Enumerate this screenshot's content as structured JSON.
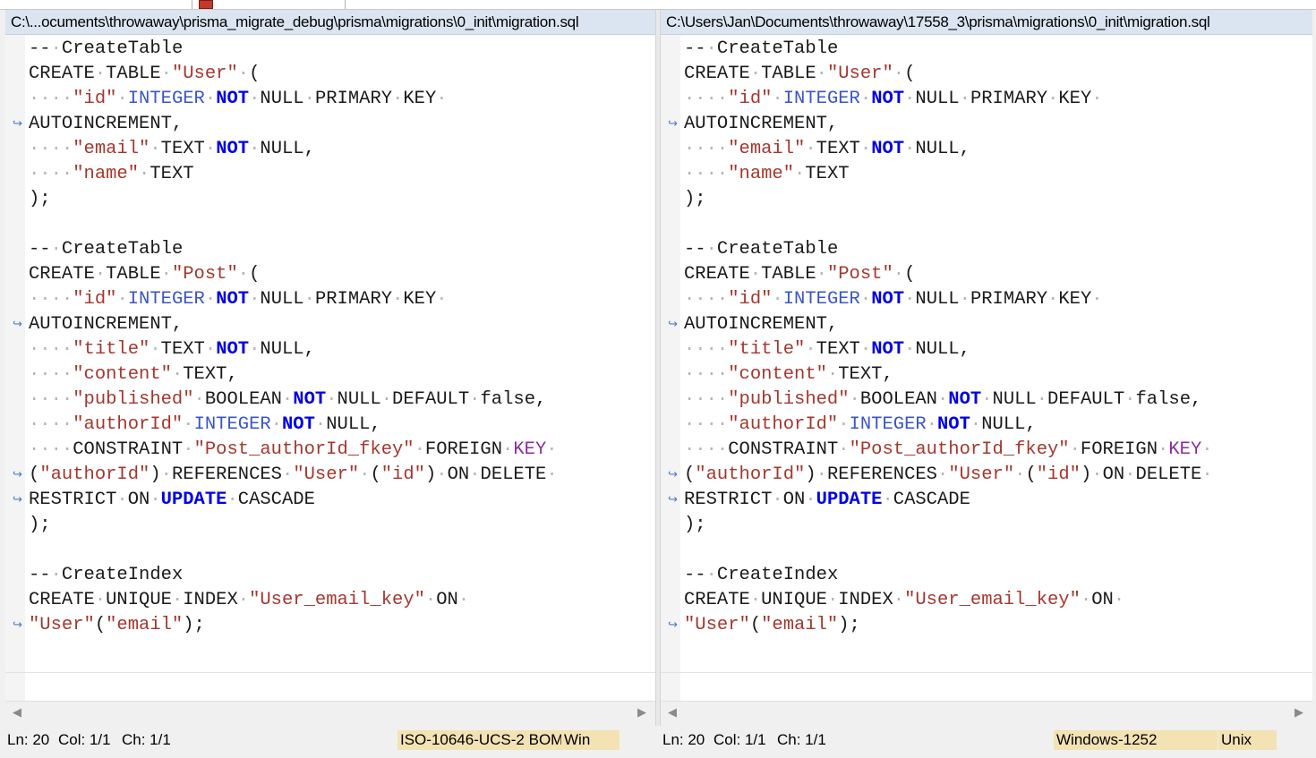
{
  "left": {
    "title": "C:\\...ocuments\\throwaway\\prisma_migrate_debug\\prisma\\migrations\\0_init\\migration.sql",
    "status": {
      "ln": "Ln: 20",
      "col": "Col: 1/1",
      "ch": "Ch: 1/1",
      "encoding": "ISO-10646-UCS-2 BOM",
      "eol": "Win"
    }
  },
  "right": {
    "title": "C:\\Users\\Jan\\Documents\\throwaway\\17558_3\\prisma\\migrations\\0_init\\migration.sql",
    "status": {
      "ln": "Ln: 20",
      "col": "Col: 1/1",
      "ch": "Ch: 1/1",
      "encoding": "Windows-1252",
      "eol": "Unix"
    }
  },
  "code_lines": [
    {
      "wrap": false,
      "tokens": [
        [
          "plain",
          "--"
        ],
        [
          "ws",
          "·"
        ],
        [
          "plain",
          "CreateTable"
        ]
      ]
    },
    {
      "wrap": false,
      "tokens": [
        [
          "plain",
          "CREATE"
        ],
        [
          "ws",
          "·"
        ],
        [
          "plain",
          "TABLE"
        ],
        [
          "ws",
          "·"
        ],
        [
          "str",
          "\"User\""
        ],
        [
          "ws",
          "·"
        ],
        [
          "plain",
          "("
        ]
      ]
    },
    {
      "wrap": false,
      "tokens": [
        [
          "ws",
          "····"
        ],
        [
          "str",
          "\"id\""
        ],
        [
          "ws",
          "·"
        ],
        [
          "kw-blue",
          "INTEGER"
        ],
        [
          "ws",
          "·"
        ],
        [
          "kw-bold",
          "NOT"
        ],
        [
          "ws",
          "·"
        ],
        [
          "plain",
          "NULL"
        ],
        [
          "ws",
          "·"
        ],
        [
          "plain",
          "PRIMARY"
        ],
        [
          "ws",
          "·"
        ],
        [
          "plain",
          "KEY"
        ],
        [
          "ws",
          "·"
        ]
      ]
    },
    {
      "wrap": true,
      "tokens": [
        [
          "plain",
          "AUTOINCREMENT,"
        ]
      ]
    },
    {
      "wrap": false,
      "tokens": [
        [
          "ws",
          "····"
        ],
        [
          "str",
          "\"email\""
        ],
        [
          "ws",
          "·"
        ],
        [
          "plain",
          "TEXT"
        ],
        [
          "ws",
          "·"
        ],
        [
          "kw-bold",
          "NOT"
        ],
        [
          "ws",
          "·"
        ],
        [
          "plain",
          "NULL,"
        ]
      ]
    },
    {
      "wrap": false,
      "tokens": [
        [
          "ws",
          "····"
        ],
        [
          "str",
          "\"name\""
        ],
        [
          "ws",
          "·"
        ],
        [
          "plain",
          "TEXT"
        ]
      ]
    },
    {
      "wrap": false,
      "tokens": [
        [
          "plain",
          ");"
        ]
      ]
    },
    {
      "wrap": false,
      "tokens": []
    },
    {
      "wrap": false,
      "tokens": [
        [
          "plain",
          "--"
        ],
        [
          "ws",
          "·"
        ],
        [
          "plain",
          "CreateTable"
        ]
      ]
    },
    {
      "wrap": false,
      "tokens": [
        [
          "plain",
          "CREATE"
        ],
        [
          "ws",
          "·"
        ],
        [
          "plain",
          "TABLE"
        ],
        [
          "ws",
          "·"
        ],
        [
          "str",
          "\"Post\""
        ],
        [
          "ws",
          "·"
        ],
        [
          "plain",
          "("
        ]
      ]
    },
    {
      "wrap": false,
      "tokens": [
        [
          "ws",
          "····"
        ],
        [
          "str",
          "\"id\""
        ],
        [
          "ws",
          "·"
        ],
        [
          "kw-blue",
          "INTEGER"
        ],
        [
          "ws",
          "·"
        ],
        [
          "kw-bold",
          "NOT"
        ],
        [
          "ws",
          "·"
        ],
        [
          "plain",
          "NULL"
        ],
        [
          "ws",
          "·"
        ],
        [
          "plain",
          "PRIMARY"
        ],
        [
          "ws",
          "·"
        ],
        [
          "plain",
          "KEY"
        ],
        [
          "ws",
          "·"
        ]
      ]
    },
    {
      "wrap": true,
      "tokens": [
        [
          "plain",
          "AUTOINCREMENT,"
        ]
      ]
    },
    {
      "wrap": false,
      "tokens": [
        [
          "ws",
          "····"
        ],
        [
          "str",
          "\"title\""
        ],
        [
          "ws",
          "·"
        ],
        [
          "plain",
          "TEXT"
        ],
        [
          "ws",
          "·"
        ],
        [
          "kw-bold",
          "NOT"
        ],
        [
          "ws",
          "·"
        ],
        [
          "plain",
          "NULL,"
        ]
      ]
    },
    {
      "wrap": false,
      "tokens": [
        [
          "ws",
          "····"
        ],
        [
          "str",
          "\"content\""
        ],
        [
          "ws",
          "·"
        ],
        [
          "plain",
          "TEXT,"
        ]
      ]
    },
    {
      "wrap": false,
      "tokens": [
        [
          "ws",
          "····"
        ],
        [
          "str",
          "\"published\""
        ],
        [
          "ws",
          "·"
        ],
        [
          "plain",
          "BOOLEAN"
        ],
        [
          "ws",
          "·"
        ],
        [
          "kw-bold",
          "NOT"
        ],
        [
          "ws",
          "·"
        ],
        [
          "plain",
          "NULL"
        ],
        [
          "ws",
          "·"
        ],
        [
          "plain",
          "DEFAULT"
        ],
        [
          "ws",
          "·"
        ],
        [
          "plain",
          "false,"
        ]
      ]
    },
    {
      "wrap": false,
      "tokens": [
        [
          "ws",
          "····"
        ],
        [
          "str",
          "\"authorId\""
        ],
        [
          "ws",
          "·"
        ],
        [
          "kw-blue",
          "INTEGER"
        ],
        [
          "ws",
          "·"
        ],
        [
          "kw-bold",
          "NOT"
        ],
        [
          "ws",
          "·"
        ],
        [
          "plain",
          "NULL,"
        ]
      ]
    },
    {
      "wrap": false,
      "tokens": [
        [
          "ws",
          "····"
        ],
        [
          "plain",
          "CONSTRAINT"
        ],
        [
          "ws",
          "·"
        ],
        [
          "str",
          "\"Post_authorId_fkey\""
        ],
        [
          "ws",
          "·"
        ],
        [
          "plain",
          "FOREIGN"
        ],
        [
          "ws",
          "·"
        ],
        [
          "kw-purple",
          "KEY"
        ],
        [
          "ws",
          "·"
        ]
      ]
    },
    {
      "wrap": true,
      "tokens": [
        [
          "plain",
          "("
        ],
        [
          "str",
          "\"authorId\""
        ],
        [
          "plain",
          ")"
        ],
        [
          "ws",
          "·"
        ],
        [
          "plain",
          "REFERENCES"
        ],
        [
          "ws",
          "·"
        ],
        [
          "str",
          "\"User\""
        ],
        [
          "ws",
          "·"
        ],
        [
          "plain",
          "("
        ],
        [
          "str",
          "\"id\""
        ],
        [
          "plain",
          ")"
        ],
        [
          "ws",
          "·"
        ],
        [
          "plain",
          "ON"
        ],
        [
          "ws",
          "·"
        ],
        [
          "plain",
          "DELETE"
        ],
        [
          "ws",
          "·"
        ]
      ]
    },
    {
      "wrap": true,
      "tokens": [
        [
          "plain",
          "RESTRICT"
        ],
        [
          "ws",
          "·"
        ],
        [
          "plain",
          "ON"
        ],
        [
          "ws",
          "·"
        ],
        [
          "kw-bold",
          "UPDATE"
        ],
        [
          "ws",
          "·"
        ],
        [
          "plain",
          "CASCADE"
        ]
      ]
    },
    {
      "wrap": false,
      "tokens": [
        [
          "plain",
          ");"
        ]
      ]
    },
    {
      "wrap": false,
      "tokens": []
    },
    {
      "wrap": false,
      "tokens": [
        [
          "plain",
          "--"
        ],
        [
          "ws",
          "·"
        ],
        [
          "plain",
          "CreateIndex"
        ]
      ]
    },
    {
      "wrap": false,
      "tokens": [
        [
          "plain",
          "CREATE"
        ],
        [
          "ws",
          "·"
        ],
        [
          "plain",
          "UNIQUE"
        ],
        [
          "ws",
          "·"
        ],
        [
          "plain",
          "INDEX"
        ],
        [
          "ws",
          "·"
        ],
        [
          "str",
          "\"User_email_key\""
        ],
        [
          "ws",
          "·"
        ],
        [
          "plain",
          "ON"
        ],
        [
          "ws",
          "·"
        ]
      ]
    },
    {
      "wrap": true,
      "tokens": [
        [
          "str",
          "\"User\""
        ],
        [
          "plain",
          "("
        ],
        [
          "str",
          "\"email\""
        ],
        [
          "plain",
          ");"
        ]
      ]
    }
  ],
  "wrap_glyph": "↪",
  "scroll_left_glyph": "◀",
  "scroll_right_glyph": "▶"
}
